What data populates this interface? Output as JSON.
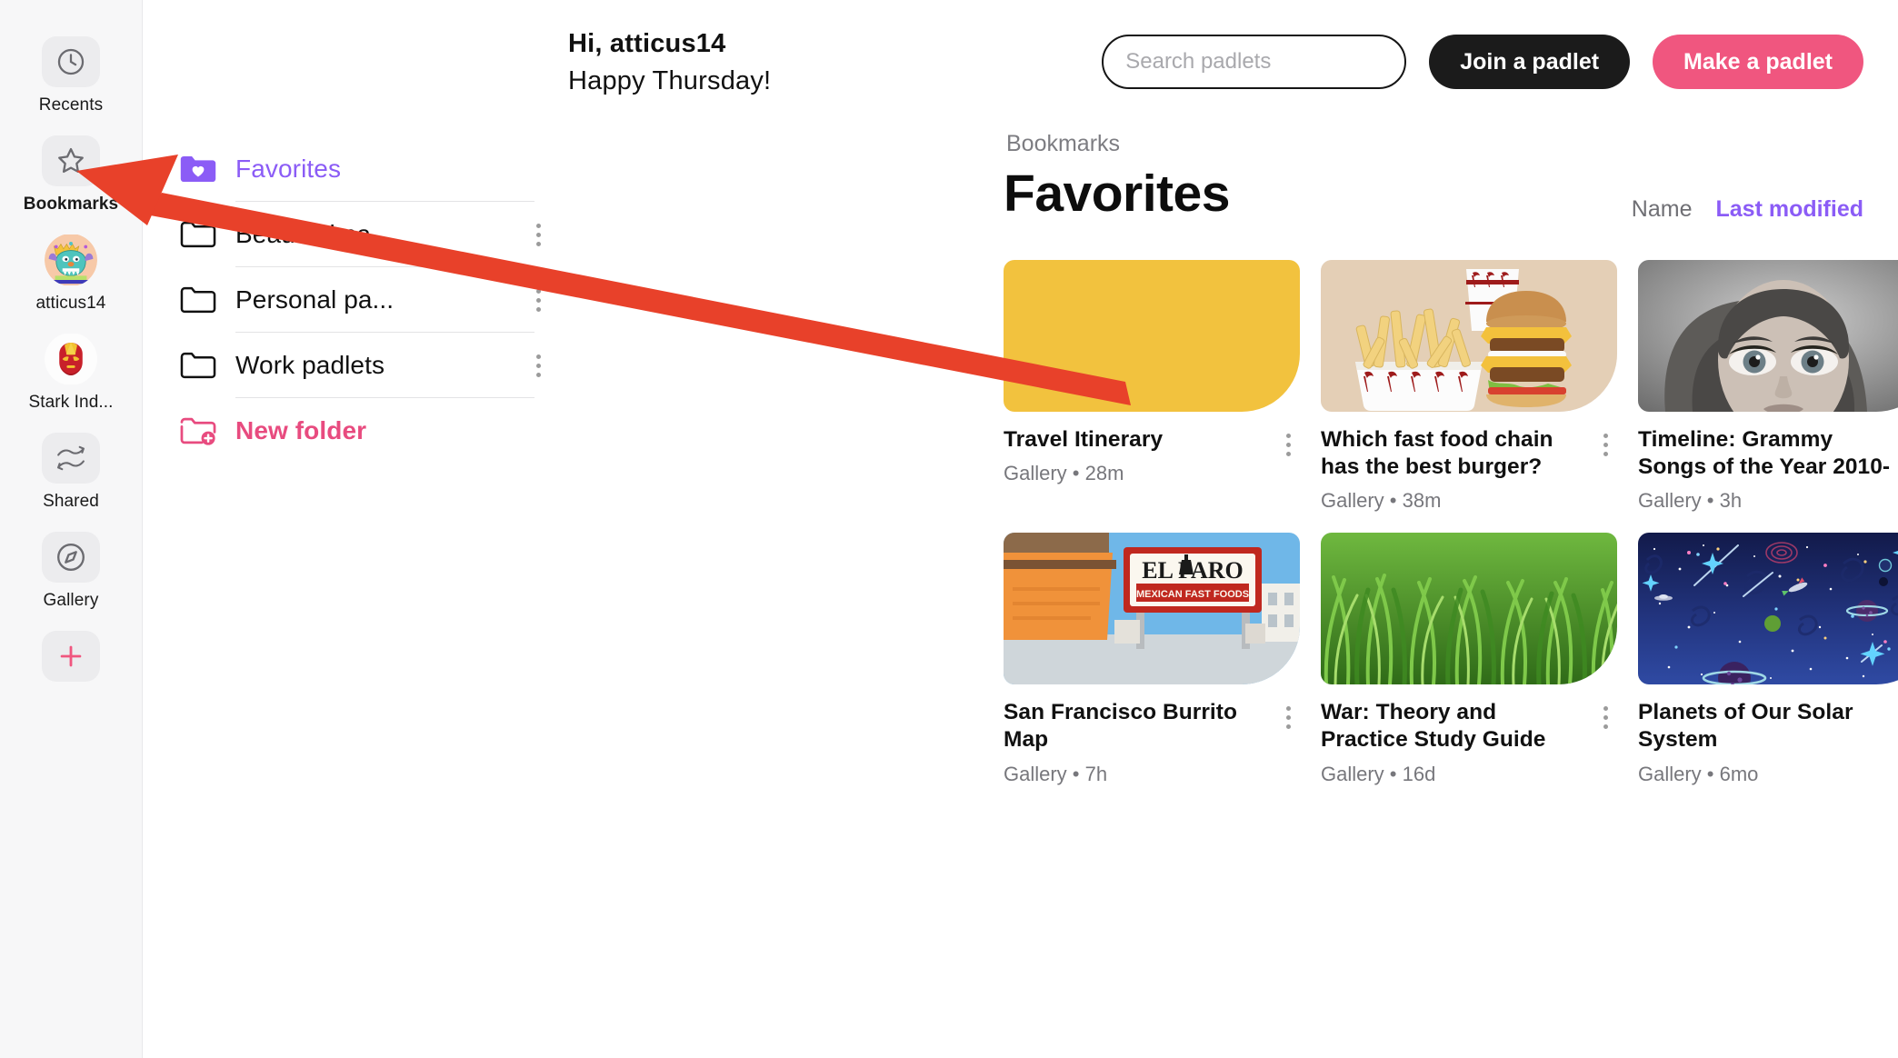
{
  "rail": {
    "items": [
      {
        "label": "Recents",
        "icon": "clock-icon",
        "active": false
      },
      {
        "label": "Bookmarks",
        "icon": "star-icon",
        "active": true
      },
      {
        "label": "atticus14",
        "icon": "avatar-monster",
        "active": false
      },
      {
        "label": "Stark Ind...",
        "icon": "avatar-ironman",
        "active": false
      },
      {
        "label": "Shared",
        "icon": "shared-icon",
        "active": false
      },
      {
        "label": "Gallery",
        "icon": "gallery-compass-icon",
        "active": false
      },
      {
        "label": "",
        "icon": "plus-icon",
        "active": false
      }
    ]
  },
  "greeting": {
    "hi": "Hi, atticus14",
    "day": "Happy Thursday!"
  },
  "topbar": {
    "search_placeholder": "Search padlets",
    "search_value": "",
    "join_label": "Join a padlet",
    "make_label": "Make a padlet"
  },
  "folders": {
    "items": [
      {
        "label": "Favorites",
        "icon": "folder-heart-icon",
        "active": true,
        "kebab": false,
        "divider": true
      },
      {
        "label": "Beautiful pa...",
        "icon": "folder-icon",
        "active": false,
        "kebab": true,
        "divider": true
      },
      {
        "label": "Personal pa...",
        "icon": "folder-icon",
        "active": false,
        "kebab": true,
        "divider": true
      },
      {
        "label": "Work padlets",
        "icon": "folder-icon",
        "active": false,
        "kebab": true,
        "divider": true
      },
      {
        "label": "New folder",
        "icon": "folder-plus-icon",
        "active": false,
        "kebab": false,
        "divider": false
      }
    ]
  },
  "content": {
    "breadcrumb": "Bookmarks",
    "title": "Favorites",
    "sorters": [
      {
        "label": "Name",
        "active": false
      },
      {
        "label": "Last modified",
        "active": true
      }
    ],
    "cards": [
      {
        "title": "Travel Itinerary",
        "meta": "Gallery • 28m",
        "thumb": "plain-yellow",
        "color": "#F2C23E"
      },
      {
        "title": "Which fast food chain has the best burger?",
        "meta": "Gallery • 38m",
        "thumb": "burger-meal",
        "color": "#E3CDB4"
      },
      {
        "title": "Timeline: Grammy Songs of the Year 2010-",
        "meta": "Gallery • 3h",
        "thumb": "portrait-bw",
        "color": "#8e8e8e"
      },
      {
        "title": "San Francisco Burrito Map",
        "meta": "Gallery • 7h",
        "thumb": "taco-sign",
        "color": "#F0923A"
      },
      {
        "title": "War: Theory and Practice Study Guide",
        "meta": "Gallery • 16d",
        "thumb": "grass-field",
        "color": "#4E9A2E"
      },
      {
        "title": "Planets of Our Solar System",
        "meta": "Gallery • 6mo",
        "thumb": "space-scene",
        "color": "#1B2A6B"
      }
    ]
  },
  "annotation": {
    "arrow_color": "#E8412A",
    "points_to": "Bookmarks"
  },
  "colors": {
    "accent_purple": "#8b5cf6",
    "accent_pink": "#e84b7f",
    "button_pink": "#f0567f",
    "button_dark": "#1b1b1b"
  }
}
